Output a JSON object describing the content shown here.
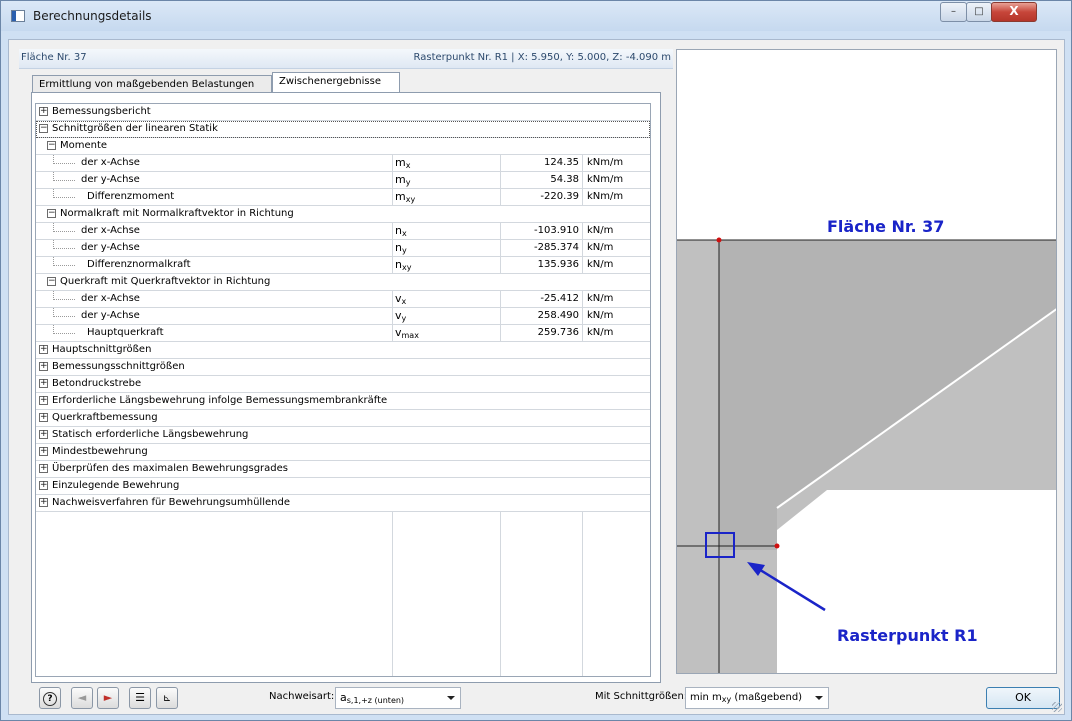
{
  "window": {
    "title": "Berechnungsdetails",
    "controls": {
      "minimize": "–",
      "maximize": "□",
      "close": "X"
    }
  },
  "infobar": {
    "surface": "Fläche Nr. 37",
    "grid_point": "Rasterpunkt Nr. R1 | X: 5.950, Y: 5.000, Z: -4.090 m"
  },
  "tabs": [
    "Ermittlung von maßgebenden Belastungen",
    "Zwischenergebnisse"
  ],
  "grid": {
    "rows": [
      {
        "level": 0,
        "toggle": "+",
        "name": "Bemessungsbericht"
      },
      {
        "level": 0,
        "toggle": "−",
        "name": "Schnittgrößen der linearen Statik",
        "focus": true
      },
      {
        "level": 1,
        "toggle": "−",
        "name": "Momente"
      },
      {
        "level": 2,
        "name": "der x-Achse",
        "sym": "m",
        "sub": "x",
        "value": "124.35",
        "unit": "kNm/m"
      },
      {
        "level": 2,
        "name": "der y-Achse",
        "sym": "m",
        "sub": "y",
        "value": "54.38",
        "unit": "kNm/m"
      },
      {
        "level": 2,
        "name": "Differenzmoment",
        "sym": "m",
        "sub": "xy",
        "value": "-220.39",
        "unit": "kNm/m"
      },
      {
        "level": 1,
        "toggle": "−",
        "name": "Normalkraft mit Normalkraftvektor in Richtung"
      },
      {
        "level": 2,
        "name": "der x-Achse",
        "sym": "n",
        "sub": "x",
        "value": "-103.910",
        "unit": "kN/m"
      },
      {
        "level": 2,
        "name": "der y-Achse",
        "sym": "n",
        "sub": "y",
        "value": "-285.374",
        "unit": "kN/m"
      },
      {
        "level": 2,
        "name": "Differenznormalkraft",
        "sym": "n",
        "sub": "xy",
        "value": "135.936",
        "unit": "kN/m"
      },
      {
        "level": 1,
        "toggle": "−",
        "name": "Querkraft mit Querkraftvektor in Richtung"
      },
      {
        "level": 2,
        "name": "der x-Achse",
        "sym": "v",
        "sub": "x",
        "value": "-25.412",
        "unit": "kN/m"
      },
      {
        "level": 2,
        "name": "der y-Achse",
        "sym": "v",
        "sub": "y",
        "value": "258.490",
        "unit": "kN/m"
      },
      {
        "level": 2,
        "name": "Hauptquerkraft",
        "sym": "v",
        "sub": "max",
        "value": "259.736",
        "unit": "kN/m"
      },
      {
        "level": 0,
        "toggle": "+",
        "name": "Hauptschnittgrößen"
      },
      {
        "level": 0,
        "toggle": "+",
        "name": "Bemessungsschnittgrößen"
      },
      {
        "level": 0,
        "toggle": "+",
        "name": "Betondruckstrebe"
      },
      {
        "level": 0,
        "toggle": "+",
        "name": "Erforderliche Längsbewehrung infolge Bemessungsmembrankräfte"
      },
      {
        "level": 0,
        "toggle": "+",
        "name": "Querkraftbemessung"
      },
      {
        "level": 0,
        "toggle": "+",
        "name": "Statisch erforderliche Längsbewehrung"
      },
      {
        "level": 0,
        "toggle": "+",
        "name": "Mindestbewehrung"
      },
      {
        "level": 0,
        "toggle": "+",
        "name": "Überprüfen des maximalen Bewehrungsgrades"
      },
      {
        "level": 0,
        "toggle": "+",
        "name": "Einzulegende Bewehrung"
      },
      {
        "level": 0,
        "toggle": "+",
        "name": "Nachweisverfahren für Bewehrungsumhüllende"
      }
    ]
  },
  "graphic": {
    "surface_title": "Fläche Nr. 37",
    "grid_point_label": "Rasterpunkt R1",
    "surface_fill": "#c0c0c0",
    "highlight_color": "#1a24c8",
    "node_color": "#d01010"
  },
  "bottom": {
    "help_icon": "help-icon",
    "prev_icon": "arrow-left-icon",
    "next_icon": "arrow-right-icon",
    "list_icon": "list-icon",
    "view_icon": "view-icon",
    "verification_label": "Nachweisart:",
    "verification_value_main": "a",
    "verification_value_sub": "s,1,+z (unten)",
    "forces_label": "Mit Schnittgrößen:",
    "forces_value_prefix": "min m",
    "forces_value_sub": "xy",
    "forces_value_suffix": " (maßgebend)",
    "ok_label": "OK"
  }
}
